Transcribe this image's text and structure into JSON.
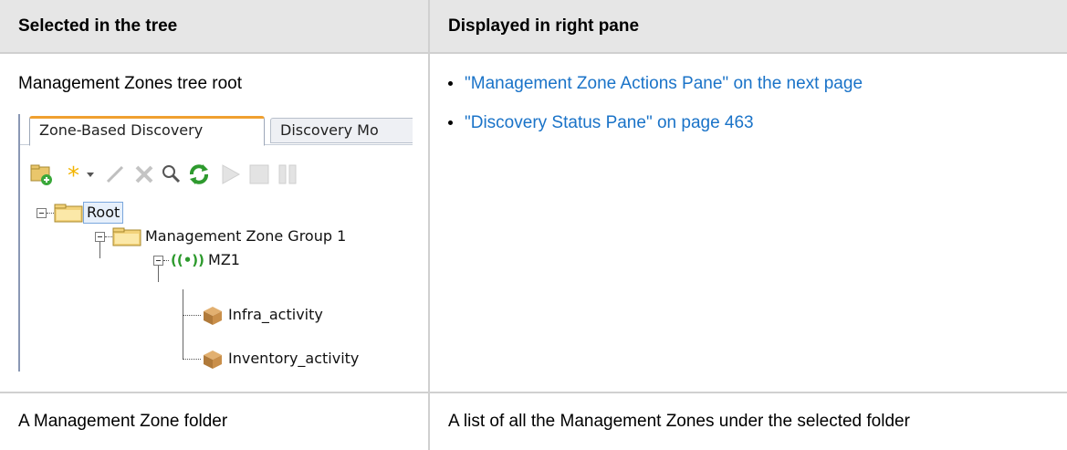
{
  "table": {
    "header": {
      "col1": "Selected in the tree",
      "col2": "Displayed in right pane"
    },
    "rows": [
      {
        "selected": "Management Zones tree root",
        "displayed_links": [
          "\"Management Zone Actions Pane\" on the next page",
          "\"Discovery Status Pane\" on page 463"
        ]
      },
      {
        "selected": "A Management Zone folder",
        "displayed": "A list of all the Management Zones under the selected folder"
      }
    ]
  },
  "screenshot": {
    "tabs": [
      "Zone-Based Discovery",
      "Discovery Mo"
    ],
    "active_tab": "Zone-Based Discovery",
    "toolbar_icons": [
      "new-folder-icon",
      "new-item-icon",
      "dropdown-arrow-icon",
      "edit-icon",
      "delete-icon",
      "search-icon",
      "refresh-icon",
      "play-icon",
      "stop-icon",
      "pause-icon"
    ],
    "tree": {
      "root": "Root",
      "group": "Management Zone Group 1",
      "zone": "MZ1",
      "zone_icon": "((•))",
      "activities": [
        "Infra_activity",
        "Inventory_activity"
      ]
    }
  },
  "colors": {
    "link": "#1a73c8",
    "header_bg": "#e6e6e6",
    "grid": "#d0d0d0"
  }
}
